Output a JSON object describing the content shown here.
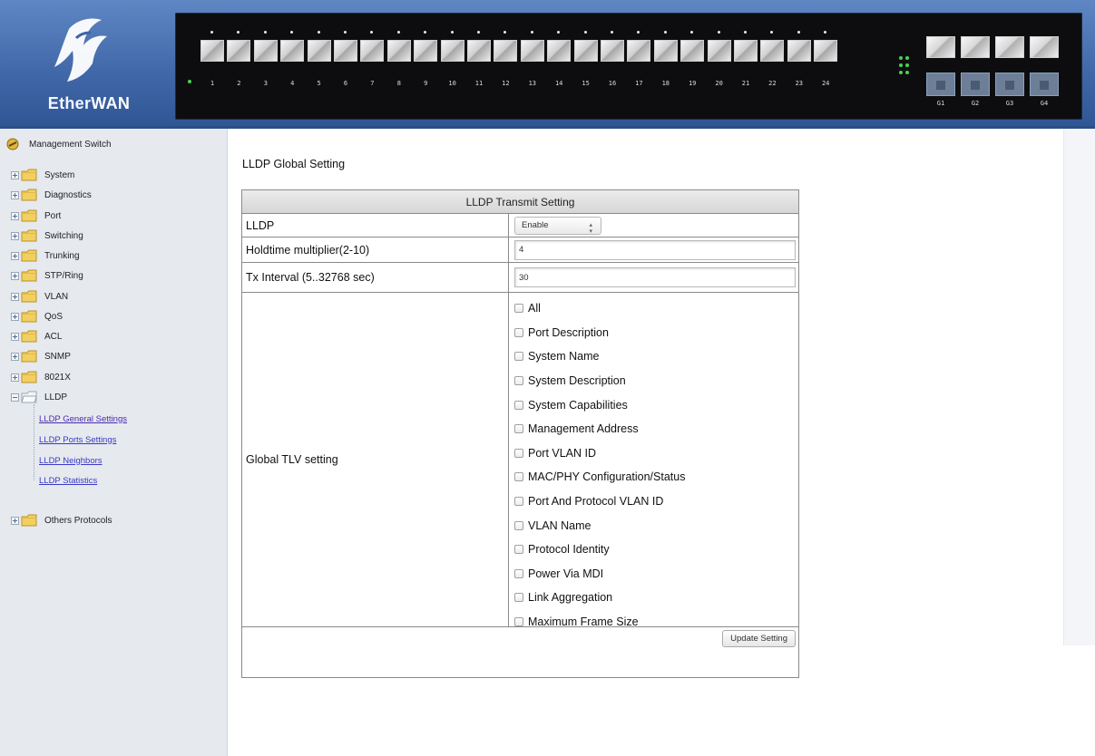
{
  "brand": {
    "logo_text_prefix": "Ether",
    "logo_text_suffix": "WAN",
    "colors": {
      "header": "#4b73b6",
      "panel": "#0d0d0f",
      "link": "#3a3ac8"
    }
  },
  "device_panel": {
    "port_numbers": [
      "1",
      "2",
      "3",
      "4",
      "5",
      "6",
      "7",
      "8",
      "9",
      "10",
      "11",
      "12",
      "13",
      "14",
      "15",
      "16",
      "17",
      "18",
      "19",
      "20",
      "21",
      "22",
      "23",
      "24"
    ],
    "uplink_labels": [
      "G1",
      "G2",
      "G3",
      "G4"
    ]
  },
  "sidebar": {
    "root_label": "Management Switch",
    "items": [
      {
        "label": "System"
      },
      {
        "label": "Diagnostics"
      },
      {
        "label": "Port"
      },
      {
        "label": "Switching"
      },
      {
        "label": "Trunking"
      },
      {
        "label": "STP/Ring"
      },
      {
        "label": "VLAN"
      },
      {
        "label": "QoS"
      },
      {
        "label": "ACL"
      },
      {
        "label": "SNMP"
      },
      {
        "label": "8021X"
      },
      {
        "label": "LLDP"
      },
      {
        "label": "Others Protocols"
      }
    ],
    "lldp_children": [
      {
        "label": "LLDP General Settings"
      },
      {
        "label": "LLDP Ports Settings"
      },
      {
        "label": "LLDP Neighbors"
      },
      {
        "label": "LLDP Statistics"
      }
    ]
  },
  "main": {
    "title": "LLDP Global Setting",
    "table": {
      "header": "LLDP Transmit Setting",
      "rows": {
        "lldp": {
          "label": "LLDP",
          "value": "Enable"
        },
        "holdtime": {
          "label": "Holdtime multiplier(2-10)",
          "value": "4"
        },
        "tx_interval": {
          "label": "Tx Interval (5..32768 sec)",
          "value": "30"
        },
        "tlv": {
          "label": "Global TLV setting"
        }
      },
      "tlv_options": [
        "All",
        "Port Description",
        "System Name",
        "System Description",
        "System Capabilities",
        "Management Address",
        "Port VLAN ID",
        "MAC/PHY Configuration/Status",
        "Port And Protocol VLAN ID",
        "VLAN Name",
        "Protocol Identity",
        "Power Via MDI",
        "Link Aggregation",
        "Maximum Frame Size"
      ],
      "update_button": "Update Setting"
    }
  }
}
